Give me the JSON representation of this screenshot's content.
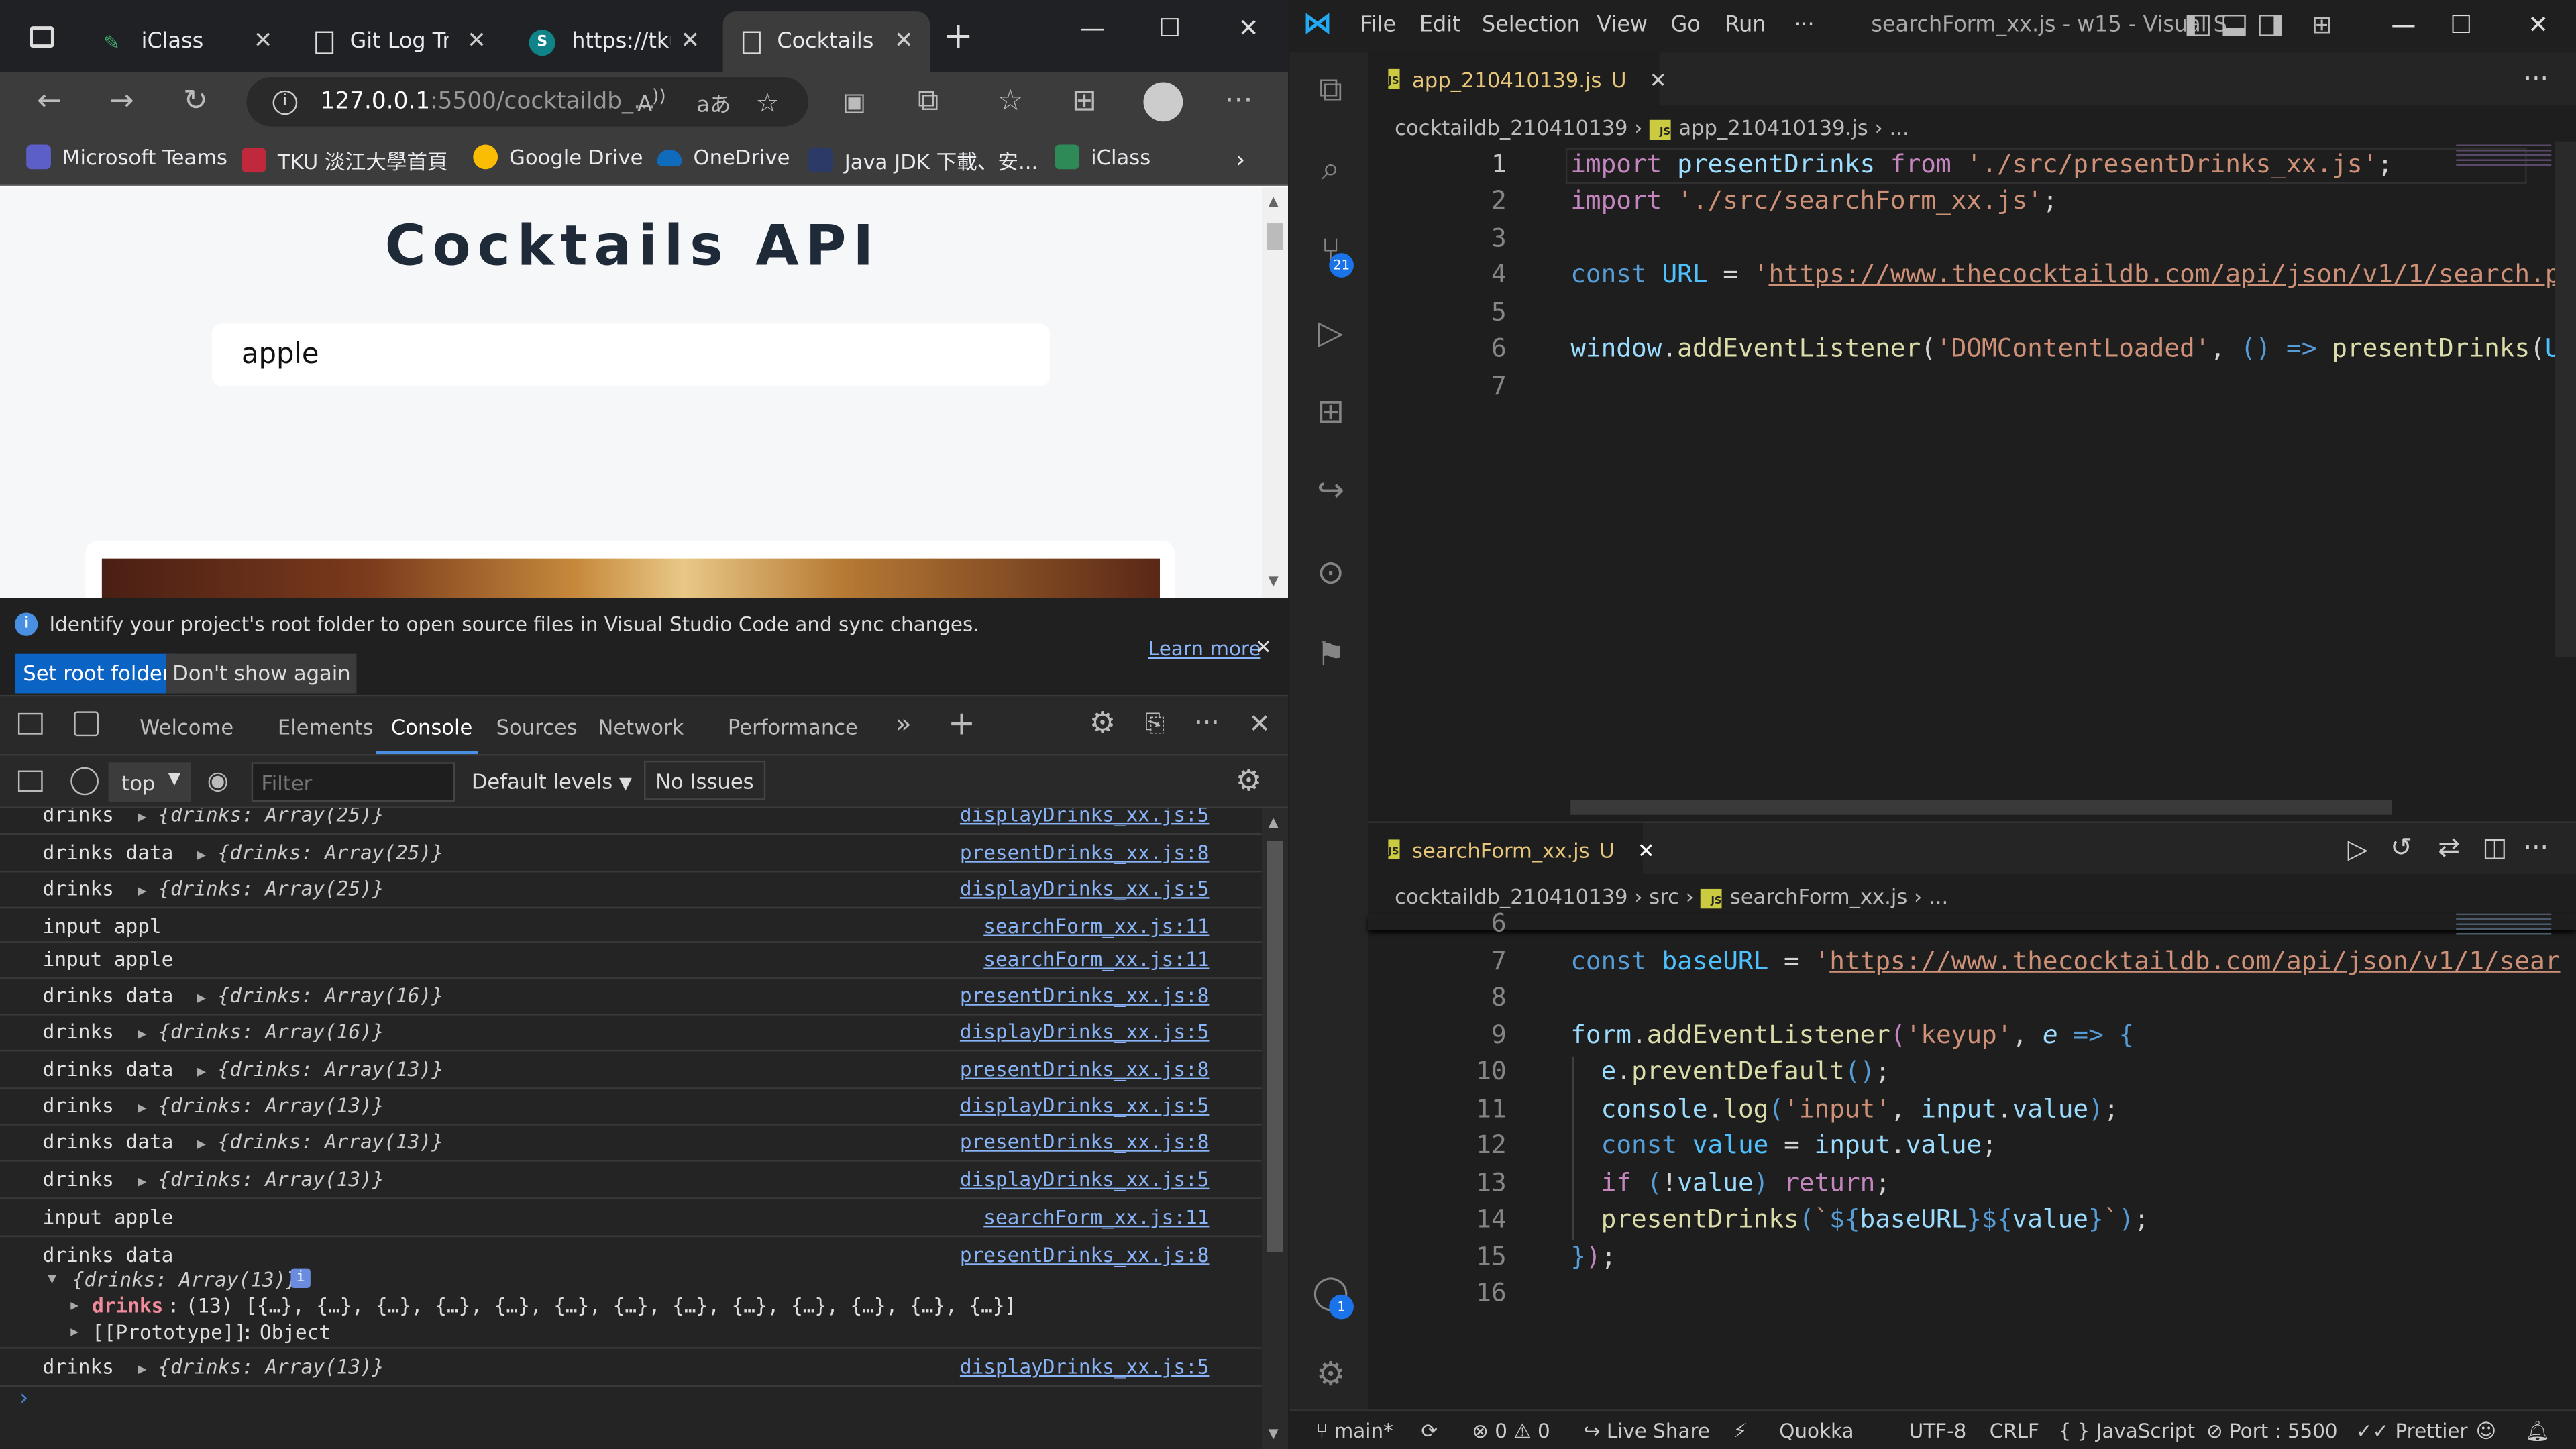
{
  "browser": {
    "tabs": [
      {
        "label": "iClass",
        "icon": "iclass-icon"
      },
      {
        "label": "Git Log Tra",
        "icon": "page-icon"
      },
      {
        "label": "https://tku",
        "icon": "sharepoint-icon"
      },
      {
        "label": "Cocktails",
        "icon": "page-icon",
        "active": true
      }
    ],
    "url_host": "127.0.0.1",
    "url_path": ":5500/cocktaildb_...",
    "favorites": [
      {
        "label": "Microsoft Teams",
        "color": "#5b5fc7"
      },
      {
        "label": "TKU 淡江大學首頁",
        "color": "#c0283c"
      },
      {
        "label": "Google Drive",
        "color": "#fbbc04"
      },
      {
        "label": "OneDrive",
        "color": "#0f6cbd"
      },
      {
        "label": "Java JDK 下載、安...",
        "color": "#2b3a67"
      },
      {
        "label": "iClass",
        "color": "#2e8b57"
      }
    ],
    "page": {
      "title": "Cocktails API",
      "search_value": "apple"
    }
  },
  "devtools": {
    "info_text": "Identify your project's root folder to open source files in Visual Studio Code and sync changes.",
    "learn_more": "Learn more",
    "set_root": "Set root folder",
    "dont_show": "Don't show again",
    "tabs": [
      "Welcome",
      "Elements",
      "Console",
      "Sources",
      "Network",
      "Performance"
    ],
    "active_tab": "Console",
    "context": "top",
    "filter_placeholder": "Filter",
    "levels": "Default levels",
    "issues": "No Issues",
    "rows": [
      {
        "label": "drinks",
        "obj": "{drinks: Array(25)}",
        "src": "displayDrinks_xx.js:5"
      },
      {
        "label": "drinks data",
        "obj": "{drinks: Array(25)}",
        "src": "presentDrinks_xx.js:8"
      },
      {
        "label": "drinks",
        "obj": "{drinks: Array(25)}",
        "src": "displayDrinks_xx.js:5"
      },
      {
        "label": "input appl",
        "obj": "",
        "src": "searchForm_xx.js:11"
      },
      {
        "label": "input apple",
        "obj": "",
        "src": "searchForm_xx.js:11"
      },
      {
        "label": "drinks data",
        "obj": "{drinks: Array(16)}",
        "src": "presentDrinks_xx.js:8"
      },
      {
        "label": "drinks",
        "obj": "{drinks: Array(16)}",
        "src": "displayDrinks_xx.js:5"
      },
      {
        "label": "drinks data",
        "obj": "{drinks: Array(13)}",
        "src": "presentDrinks_xx.js:8"
      },
      {
        "label": "drinks",
        "obj": "{drinks: Array(13)}",
        "src": "displayDrinks_xx.js:5"
      },
      {
        "label": "drinks data",
        "obj": "{drinks: Array(13)}",
        "src": "presentDrinks_xx.js:8"
      },
      {
        "label": "drinks",
        "obj": "{drinks: Array(13)}",
        "src": "displayDrinks_xx.js:5"
      },
      {
        "label": "input apple",
        "obj": "",
        "src": "searchForm_xx.js:11"
      }
    ],
    "expanded": {
      "label": "drinks data",
      "src": "presentDrinks_xx.js:8",
      "obj": "{drinks: Array(13)}",
      "line1_key": "drinks",
      "line1_val": "(13) [{…}, {…}, {…}, {…}, {…}, {…}, {…}, {…}, {…}, {…}, {…}, {…}, {…}]",
      "line2_key": "[[Prototype]]",
      "line2_val": "Object"
    },
    "last_row": {
      "label": "drinks",
      "obj": "{drinks: Array(13)}",
      "src": "displayDrinks_xx.js:5"
    }
  },
  "vscode": {
    "menu": [
      "File",
      "Edit",
      "Selection",
      "View",
      "Go",
      "Run",
      "···"
    ],
    "title": "searchForm_xx.js - w15 - Visual S...",
    "scm_badge": "21",
    "account_badge": "1",
    "editor1": {
      "tab": "app_210410139.js",
      "tab_status": "U",
      "breadcrumb": [
        "cocktaildb_210410139",
        "app_210410139.js",
        "..."
      ],
      "line_numbers": [
        "1",
        "2",
        "3",
        "4",
        "5",
        "6",
        "7"
      ]
    },
    "editor2": {
      "tab": "searchForm_xx.js",
      "tab_status": "U",
      "breadcrumb": [
        "cocktaildb_210410139",
        "src",
        "searchForm_xx.js",
        "..."
      ],
      "line_numbers": [
        "6",
        "7",
        "8",
        "9",
        "10",
        "11",
        "12",
        "13",
        "14",
        "15",
        "16"
      ]
    },
    "status": {
      "branch": "main*",
      "problems": "⊗ 0 ⚠ 0",
      "live_share": "Live Share",
      "quokka": "Quokka",
      "encoding": "UTF-8",
      "eol": "CRLF",
      "language": "{ } JavaScript",
      "port": "Port : 5500",
      "prettier": "Prettier"
    }
  }
}
